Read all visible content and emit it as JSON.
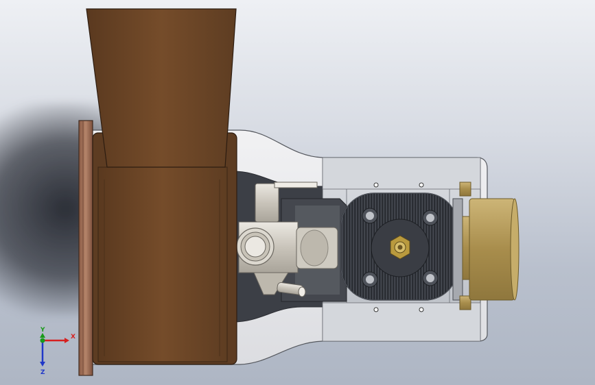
{
  "viewport": {
    "background_top": "#eef0f4",
    "background_bottom": "#aeb6c4"
  },
  "model": {
    "colors": {
      "hopper": "#6b4627",
      "hopper_shade": "#5a3a20",
      "flange": "#a3735a",
      "housing": "#e9e9ec",
      "plate": "#c9cdd3",
      "cylinder_head": "#2c2f35",
      "brass": "#b79e5a",
      "silver": "#d8d4cc"
    }
  },
  "triad": {
    "x_label": "X",
    "y_label": "Y",
    "z_label": "Z",
    "x_color": "#d62020",
    "y_color": "#1a9a1a",
    "z_color": "#2038c8"
  }
}
